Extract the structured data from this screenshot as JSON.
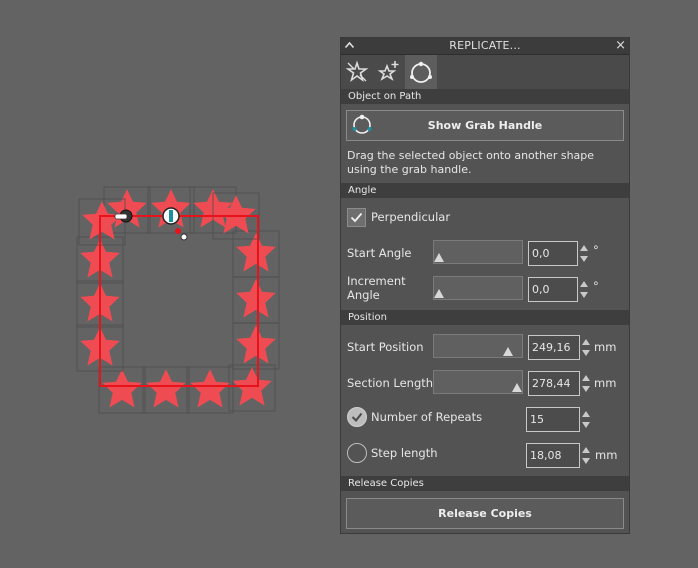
{
  "panel": {
    "title": "REPLICATE...",
    "close_glyph": "×",
    "tabs": [
      {
        "icon": "replicate-star-icon",
        "active": false
      },
      {
        "icon": "replicate-star-add-icon",
        "active": false
      },
      {
        "icon": "object-on-path-icon",
        "active": true
      }
    ]
  },
  "object_on_path": {
    "header": "Object on Path",
    "grab_button": "Show Grab Handle",
    "description": "Drag the selected object onto another shape using the grab handle."
  },
  "angle": {
    "header": "Angle",
    "perpendicular_label": "Perpendicular",
    "perpendicular_checked": true,
    "start_angle_label": "Start Angle",
    "start_angle_value": "0,0",
    "start_angle_unit": "°",
    "start_angle_slider": 0.0,
    "increment_angle_label_line1": "Increment",
    "increment_angle_label_line2": "Angle",
    "increment_angle_value": "0,0",
    "increment_angle_unit": "°",
    "increment_angle_slider": 0.0
  },
  "position": {
    "header": "Position",
    "start_position_label": "Start Position",
    "start_position_value": "249,16",
    "start_position_unit": "mm",
    "start_position_slider": 0.89,
    "section_length_label": "Section Length",
    "section_length_value": "278,44",
    "section_length_unit": "mm",
    "section_length_slider": 1.0,
    "repeats_label": "Number of Repeats",
    "repeats_selected": true,
    "repeats_value": "15",
    "step_length_label": "Step length",
    "step_length_selected": false,
    "step_length_value": "18,08",
    "step_length_unit": "mm"
  },
  "release": {
    "header": "Release Copies",
    "button": "Release Copies"
  },
  "colors": {
    "background": "#636363",
    "panel": "#535353",
    "star_fill": "#ef4b52",
    "path_red": "#e8121b"
  }
}
